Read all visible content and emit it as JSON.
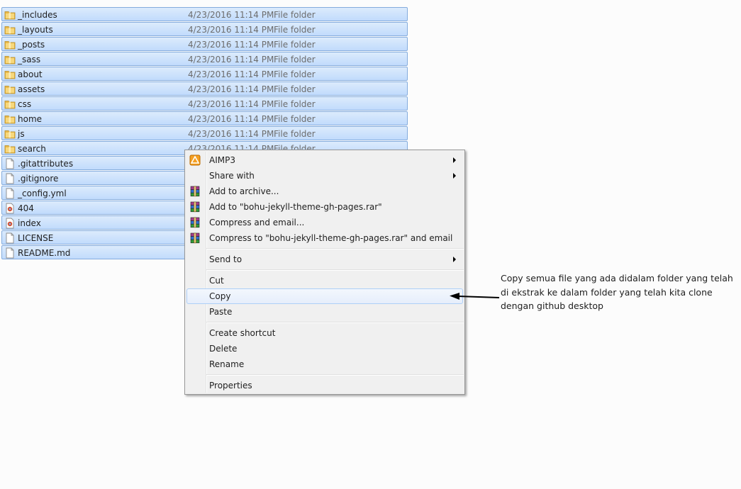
{
  "files": [
    {
      "name": "_includes",
      "date": "4/23/2016 11:14 PM",
      "type": "File folder",
      "icon": "folder-icon"
    },
    {
      "name": "_layouts",
      "date": "4/23/2016 11:14 PM",
      "type": "File folder",
      "icon": "folder-icon"
    },
    {
      "name": "_posts",
      "date": "4/23/2016 11:14 PM",
      "type": "File folder",
      "icon": "folder-icon"
    },
    {
      "name": "_sass",
      "date": "4/23/2016 11:14 PM",
      "type": "File folder",
      "icon": "folder-icon"
    },
    {
      "name": "about",
      "date": "4/23/2016 11:14 PM",
      "type": "File folder",
      "icon": "folder-icon"
    },
    {
      "name": "assets",
      "date": "4/23/2016 11:14 PM",
      "type": "File folder",
      "icon": "folder-icon"
    },
    {
      "name": "css",
      "date": "4/23/2016 11:14 PM",
      "type": "File folder",
      "icon": "folder-icon"
    },
    {
      "name": "home",
      "date": "4/23/2016 11:14 PM",
      "type": "File folder",
      "icon": "folder-icon"
    },
    {
      "name": "js",
      "date": "4/23/2016 11:14 PM",
      "type": "File folder",
      "icon": "folder-icon"
    },
    {
      "name": "search",
      "date": "4/23/2016 11:14 PM",
      "type": "File folder",
      "icon": "folder-icon"
    },
    {
      "name": ".gitattributes",
      "icon": "file-icon"
    },
    {
      "name": ".gitignore",
      "icon": "file-icon"
    },
    {
      "name": "_config.yml",
      "icon": "file-icon"
    },
    {
      "name": "404",
      "icon": "html-file-icon"
    },
    {
      "name": "index",
      "icon": "html-file-icon"
    },
    {
      "name": "LICENSE",
      "icon": "file-icon"
    },
    {
      "name": "README.md",
      "icon": "file-icon"
    }
  ],
  "context_menu": {
    "aimp3": "AIMP3",
    "share_with": "Share with",
    "add_to_archive": "Add to archive...",
    "add_to_rar": "Add to \"bohu-jekyll-theme-gh-pages.rar\"",
    "compress_email": "Compress and email...",
    "compress_rar_email": "Compress to \"bohu-jekyll-theme-gh-pages.rar\" and email",
    "send_to": "Send to",
    "cut": "Cut",
    "copy": "Copy",
    "paste": "Paste",
    "create_shortcut": "Create shortcut",
    "delete": "Delete",
    "rename": "Rename",
    "properties": "Properties"
  },
  "annotation": {
    "line1": "Copy semua file yang ada didalam folder yang telah",
    "line2": "di ekstrak ke dalam folder yang telah kita clone",
    "line3": "dengan github desktop"
  },
  "colors": {
    "selection": "#c1dbfc",
    "selection_border": "#84acdd",
    "menu_bg": "#f0f0f0",
    "highlight_border": "#aecff7"
  }
}
